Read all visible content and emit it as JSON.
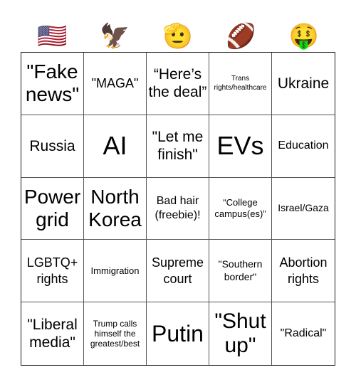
{
  "header": {
    "icons": [
      {
        "name": "us-flag-icon",
        "glyph": "🇺🇸"
      },
      {
        "name": "eagle-icon",
        "glyph": "🦅"
      },
      {
        "name": "saluting-face-icon",
        "glyph": "🫡"
      },
      {
        "name": "american-football-icon",
        "glyph": "🏈"
      },
      {
        "name": "money-mouth-face-icon",
        "glyph": "🤑"
      }
    ]
  },
  "board": {
    "rows": [
      [
        "\"Fake news\"",
        "\"MAGA\"",
        "“Here’s the deal”",
        "Trans rights/healthcare",
        "Ukraine"
      ],
      [
        "Russia",
        "AI",
        "\"Let me finish\"",
        "EVs",
        "Education"
      ],
      [
        "Power grid",
        "North Korea",
        "Bad hair (freebie)!",
        "“College campus(es)”",
        "Israel/Gaza"
      ],
      [
        "LGBTQ+ rights",
        "Immigration",
        "Supreme court",
        "\"Southern border\"",
        "Abortion rights"
      ],
      [
        "\"Liberal media\"",
        "Trump calls himself the greatest/best",
        "Putin",
        "\"Shut up\"",
        "\"Radical\""
      ]
    ]
  }
}
